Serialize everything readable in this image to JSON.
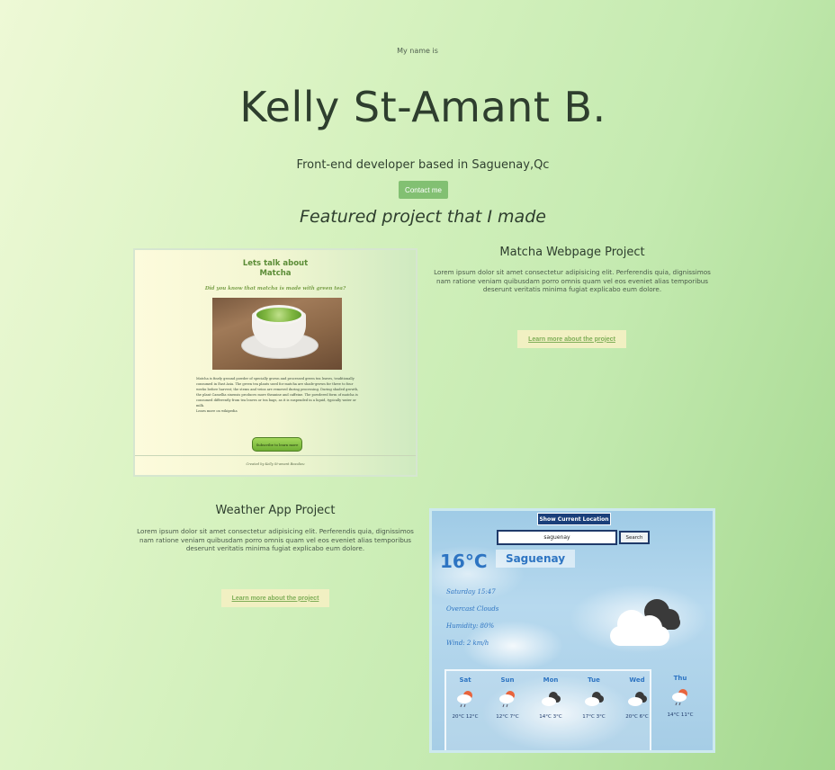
{
  "hero": {
    "intro": "My name is",
    "name": "Kelly St-Amant B.",
    "role": "Front-end developer based in Saguenay,Qc",
    "contact_label": "Contact me"
  },
  "featured_heading": "Featured project that I made",
  "projects": [
    {
      "title": "Matcha Webpage Project",
      "description": "Lorem ipsum dolor sit amet consectetur adipisicing elit. Perferendis quia, dignissimos nam ratione veniam quibusdam porro omnis quam vel eos eveniet alias temporibus deserunt veritatis minima fugiat explicabo eum dolore.",
      "link_label": "Learn more about the project",
      "preview": {
        "title_line1": "Lets talk about",
        "title_line2": "Matcha",
        "subtitle": "Did you know that matcha is made with green tea?",
        "body": "Matcha is finely ground powder of specially grown and processed green tea leaves, traditionally consumed in East Asia. The green tea plants used for matcha are shade-grown for three to four weeks before harvest; the stems and veins are removed during processing. During shaded growth, the plant Camellia sinensis produces more theanine and caffeine. The powdered form of matcha is consumed differently from tea leaves or tea bags, as it is suspended in a liquid, typically water or milk.",
        "body_link": "Learn more on wikipedia",
        "subscribe_label": "Subscribe to learn more",
        "footer": "Created by Kelly St-amant Beaulieu"
      }
    },
    {
      "title": "Weather App Project",
      "description": "Lorem ipsum dolor sit amet consectetur adipisicing elit. Perferendis quia, dignissimos nam ratione veniam quibusdam porro omnis quam vel eos eveniet alias temporibus deserunt veritatis minima fugiat explicabo eum dolore.",
      "link_label": "Learn more about the project",
      "preview": {
        "location_button": "Show Current Location",
        "search_value": "saguenay",
        "search_button": "Search",
        "temperature": "16°C",
        "city": "Saguenay",
        "datetime": "Saturday 15:47",
        "condition": "Overcast Clouds",
        "humidity": "Humidity: 80%",
        "wind": "Wind: 2 km/h",
        "forecast": [
          {
            "day": "Sat",
            "temps": "20°C 12°C",
            "icon": "rain-sun-cloud-icon"
          },
          {
            "day": "Sun",
            "temps": "12°C 7°C",
            "icon": "rain-sun-cloud-icon"
          },
          {
            "day": "Mon",
            "temps": "14°C 3°C",
            "icon": "dark-cloud-icon"
          },
          {
            "day": "Tue",
            "temps": "17°C 3°C",
            "icon": "dark-cloud-icon"
          },
          {
            "day": "Wed",
            "temps": "20°C 6°C",
            "icon": "dark-cloud-icon"
          },
          {
            "day": "Thu",
            "temps": "14°C 11°C",
            "icon": "rain-sun-cloud-icon"
          }
        ]
      }
    }
  ],
  "colors": {
    "accent_green": "#82c072",
    "weather_blue": "#2d74c2",
    "link_bg": "#f1f0c2"
  }
}
